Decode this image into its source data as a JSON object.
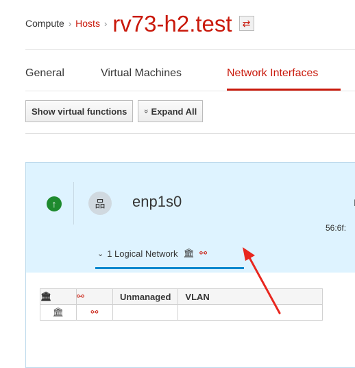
{
  "breadcrumb": {
    "item1": "Compute",
    "item2": "Hosts",
    "sep": "›",
    "title": "rv73-h2.test",
    "swap_glyph": "⇄"
  },
  "tabs": [
    {
      "label": "General"
    },
    {
      "label": "Virtual Machines"
    },
    {
      "label": "Network Interfaces"
    }
  ],
  "toolbar": {
    "show_vf_label": "Show virtual functions",
    "expand_all_label": "Expand All",
    "expand_glyph": "»"
  },
  "nic": {
    "status_icon": "up-arrow-icon",
    "status_glyph": "↑",
    "icon": "network-tree-icon",
    "icon_glyph": "品",
    "name": "enp1s0",
    "mac": "56:6f:",
    "cut_text": "I"
  },
  "logical_network": {
    "chev": "⌄",
    "label": "1 Logical Network",
    "bank_glyph": "🏛",
    "unlink_glyph": "⚯"
  },
  "table": {
    "headers": [
      "",
      "",
      "Unmanaged",
      "VLAN"
    ],
    "rows": [
      {
        "c1": "🏛",
        "c2": "⚯",
        "c3": "",
        "c4": ""
      }
    ]
  },
  "colors": {
    "accent": "#c9190b",
    "link_blue": "#0088ce",
    "card_bg": "#def3ff",
    "status_green": "#1e8a2e"
  }
}
